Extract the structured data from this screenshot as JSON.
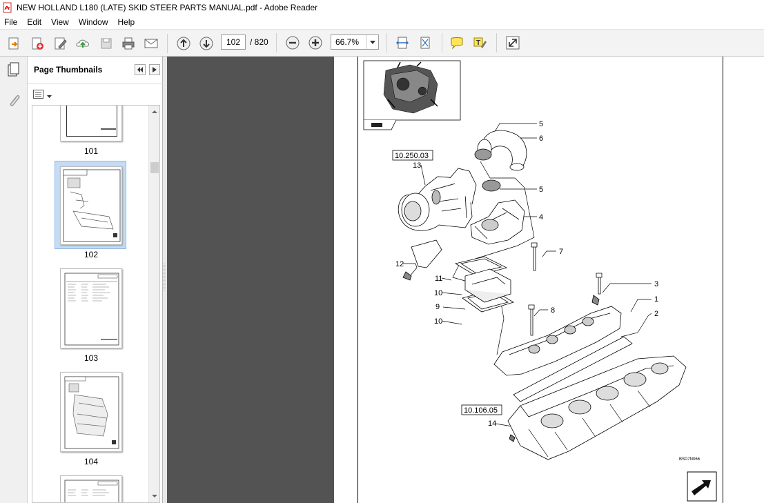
{
  "window": {
    "title": "NEW HOLLAND L180 (LATE) SKID STEER  PARTS MANUAL.pdf - Adobe Reader"
  },
  "menu": [
    "File",
    "Edit",
    "View",
    "Window",
    "Help"
  ],
  "toolbar": {
    "current_page": "102",
    "page_total": "/ 820",
    "zoom": "66.7%"
  },
  "panel": {
    "title": "Page Thumbnails",
    "thumbnails": [
      {
        "page": "101"
      },
      {
        "page": "102",
        "selected": true
      },
      {
        "page": "103"
      },
      {
        "page": "104"
      }
    ]
  },
  "document": {
    "ref_labels": [
      "10.250.03",
      "10.106.05"
    ],
    "part_numbers": [
      "5",
      "6",
      "13",
      "5",
      "4",
      "7",
      "12",
      "11",
      "10",
      "3",
      "1",
      "9",
      "8",
      "2",
      "10",
      "14"
    ],
    "figure_code": "BSD7N066"
  },
  "colors": {
    "doc_background": "#535353",
    "selection": "#c4dcf5"
  }
}
